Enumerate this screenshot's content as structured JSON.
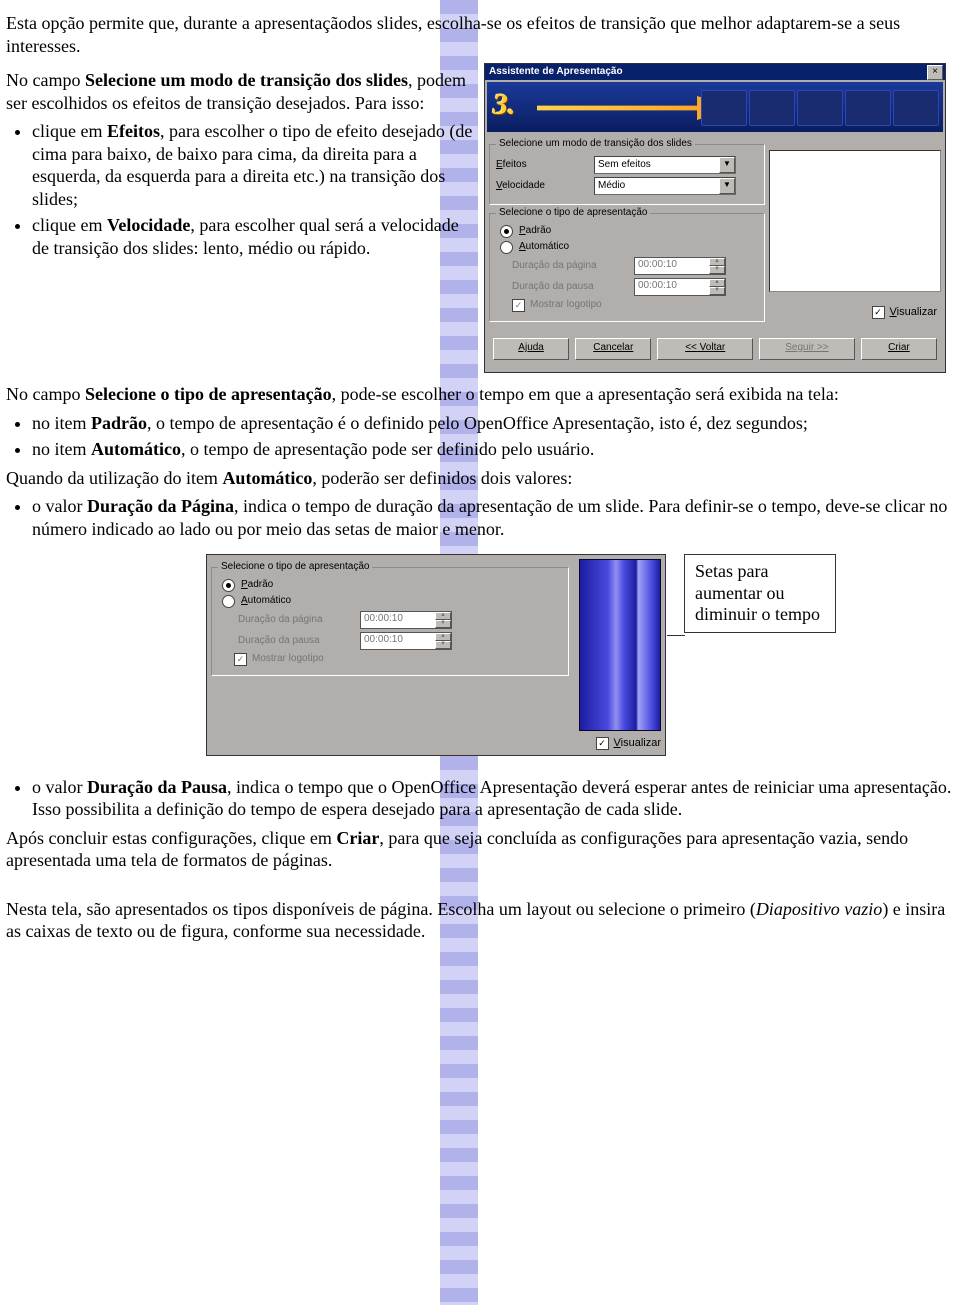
{
  "p1_a": "Esta opção permite que, durante a apresentaçãodos slides, escolha-se os efeitos de transição que melhor adaptarem-se a seus interesses.",
  "p2_a": "No campo ",
  "p2_b": "Selecione um modo de transição dos slides",
  "p2_c": ", podem ser escolhidos os efeitos de transição desejados. Para isso:",
  "li1_a": "clique em ",
  "li1_b": "Efeitos",
  "li1_c": ", para escolher o tipo de efeito desejado (de cima para baixo, de baixo para cima, da direita para a esquerda, da esquerda para a direita etc.) na transição dos slides;",
  "li2_a": "clique em ",
  "li2_b": "Velocidade",
  "li2_c": ", para escolher qual será a velocidade de transição dos slides: lento, médio ou rápido.",
  "p3_a": "No campo ",
  "p3_b": "Selecione o tipo de apresentação",
  "p3_c": ", pode-se escolher o tempo em que a apresentação será exibida na tela:",
  "li3_a": "no item ",
  "li3_b": "Padrão",
  "li3_c": ", o tempo de apresentação é o definido pelo OpenOffice Apresentação, isto é, dez segundos;",
  "li4_a": "no item ",
  "li4_b": "Automático",
  "li4_c": ", o tempo de apresentação pode ser definido pelo usuário.",
  "p4_a": "Quando da utilização do item ",
  "p4_b": "Automático",
  "p4_c": ", poderão ser definidos dois valores:",
  "li5_a": "o valor ",
  "li5_b": "Duração da Página",
  "li5_c": ", indica o tempo de duração da apresentação de um slide. Para definir-se o tempo,  deve-se clicar no número indicado ao lado ou por meio das setas de maior e menor.",
  "callout": "Setas para aumentar ou diminuir o tempo",
  "li6_a": "o valor ",
  "li6_b": "Duração da Pausa",
  "li6_c": ", indica o tempo que o OpenOffice Apresentação deverá esperar antes de reiniciar uma apresentação. Isso possibilita a definição do tempo de espera desejado para a apresentação de cada slide.",
  "p5_a": "Após concluir estas configurações, clique em ",
  "p5_b": "Criar",
  "p5_c": ", para que seja concluída as configurações para apresentação vazia, sendo apresentada uma tela de formatos de páginas.",
  "p6_a": "Nesta tela, são apresentados os tipos disponíveis de página. Escolha um layout ou selecione o primeiro (",
  "p6_b": "Diapositivo vazio",
  "p6_c": ") e insira as caixas de texto ou de figura, conforme sua necessidade.",
  "wiz": {
    "title": "Assistente de Apresentação",
    "step": "3.",
    "group1": "Selecione um modo de transição dos slides",
    "efeitos_label": "Efeitos",
    "efeitos_value": "Sem efeitos",
    "veloc_label": "Velocidade",
    "veloc_value": "Médio",
    "group2": "Selecione o tipo de apresentação",
    "padrao": "Padrão",
    "automatico": "Automático",
    "duracao_pagina": "Duração da página",
    "duracao_pausa": "Duração da pausa",
    "time_value": "00:00:10",
    "mostrar_logo": "Mostrar logotipo",
    "visualizar": "Visualizar",
    "buttons": {
      "ajuda": "Ajuda",
      "cancelar": "Cancelar",
      "voltar": "<< Voltar",
      "seguir": "Seguir >>",
      "criar": "Criar"
    }
  }
}
